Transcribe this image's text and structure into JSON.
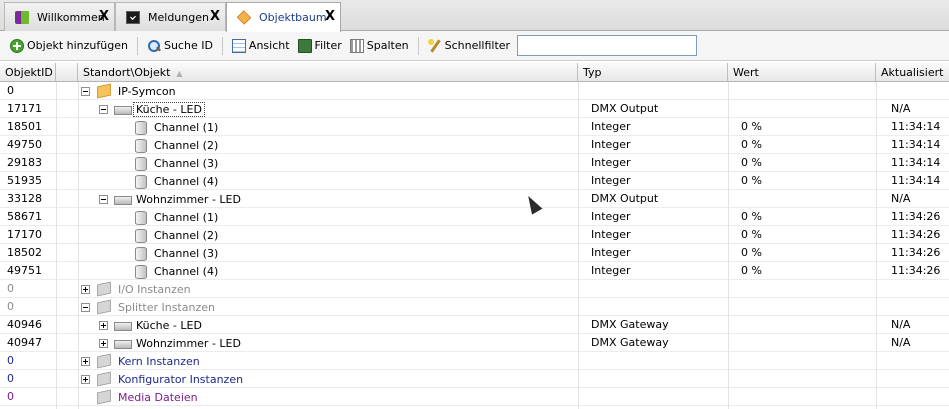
{
  "tabs": [
    {
      "label": "Willkommen",
      "icon": "welcome-icon",
      "close": "X",
      "active": false
    },
    {
      "label": "Meldungen",
      "icon": "console-icon",
      "close": "X",
      "active": false
    },
    {
      "label": "Objektbaum",
      "icon": "tree-icon",
      "close": "X",
      "active": true
    }
  ],
  "toolbar": {
    "add_object": "Objekt hinzufügen",
    "search_id": "Suche ID",
    "view": "Ansicht",
    "filter": "Filter",
    "columns": "Spalten",
    "quickfilter": "Schnellfilter",
    "quickfilter_value": ""
  },
  "columns": {
    "id": "ObjektID",
    "name": "Standort\\Objekt",
    "type": "Typ",
    "value": "Wert",
    "updated": "Aktualisiert"
  },
  "rows": [
    {
      "id": "0",
      "name": "IP-Symcon",
      "type": "",
      "value": "",
      "updated": "",
      "icon": "cube-yellow-icon"
    },
    {
      "id": "17171",
      "name": "Küche - LED",
      "type": "DMX Output",
      "value": "",
      "updated": "N/A",
      "icon": "device-icon"
    },
    {
      "id": "18501",
      "name": "Channel (1)",
      "type": "Integer",
      "value": "0 %",
      "updated": "11:34:14",
      "icon": "variable-icon"
    },
    {
      "id": "49750",
      "name": "Channel (2)",
      "type": "Integer",
      "value": "0 %",
      "updated": "11:34:14",
      "icon": "variable-icon"
    },
    {
      "id": "29183",
      "name": "Channel (3)",
      "type": "Integer",
      "value": "0 %",
      "updated": "11:34:14",
      "icon": "variable-icon"
    },
    {
      "id": "51935",
      "name": "Channel (4)",
      "type": "Integer",
      "value": "0 %",
      "updated": "11:34:14",
      "icon": "variable-icon"
    },
    {
      "id": "33128",
      "name": "Wohnzimmer - LED",
      "type": "DMX Output",
      "value": "",
      "updated": "N/A",
      "icon": "device-icon"
    },
    {
      "id": "58671",
      "name": "Channel (1)",
      "type": "Integer",
      "value": "0 %",
      "updated": "11:34:26",
      "icon": "variable-icon"
    },
    {
      "id": "17170",
      "name": "Channel (2)",
      "type": "Integer",
      "value": "0 %",
      "updated": "11:34:26",
      "icon": "variable-icon"
    },
    {
      "id": "18502",
      "name": "Channel (3)",
      "type": "Integer",
      "value": "0 %",
      "updated": "11:34:26",
      "icon": "variable-icon"
    },
    {
      "id": "49751",
      "name": "Channel (4)",
      "type": "Integer",
      "value": "0 %",
      "updated": "11:34:26",
      "icon": "variable-icon"
    },
    {
      "id": "0",
      "name": "I/O Instanzen",
      "type": "",
      "value": "",
      "updated": "",
      "icon": "cube-grey-icon"
    },
    {
      "id": "0",
      "name": "Splitter Instanzen",
      "type": "",
      "value": "",
      "updated": "",
      "icon": "cube-grey-icon"
    },
    {
      "id": "40946",
      "name": "Küche - LED",
      "type": "DMX Gateway",
      "value": "",
      "updated": "N/A",
      "icon": "device-icon"
    },
    {
      "id": "40947",
      "name": "Wohnzimmer - LED",
      "type": "DMX Gateway",
      "value": "",
      "updated": "N/A",
      "icon": "device-icon"
    },
    {
      "id": "0",
      "name": "Kern Instanzen",
      "type": "",
      "value": "",
      "updated": "",
      "icon": "cube-grey-icon"
    },
    {
      "id": "0",
      "name": "Konfigurator Instanzen",
      "type": "",
      "value": "",
      "updated": "",
      "icon": "cube-grey-icon"
    },
    {
      "id": "0",
      "name": "Media Dateien",
      "type": "",
      "value": "",
      "updated": "",
      "icon": "cube-grey-icon"
    }
  ]
}
